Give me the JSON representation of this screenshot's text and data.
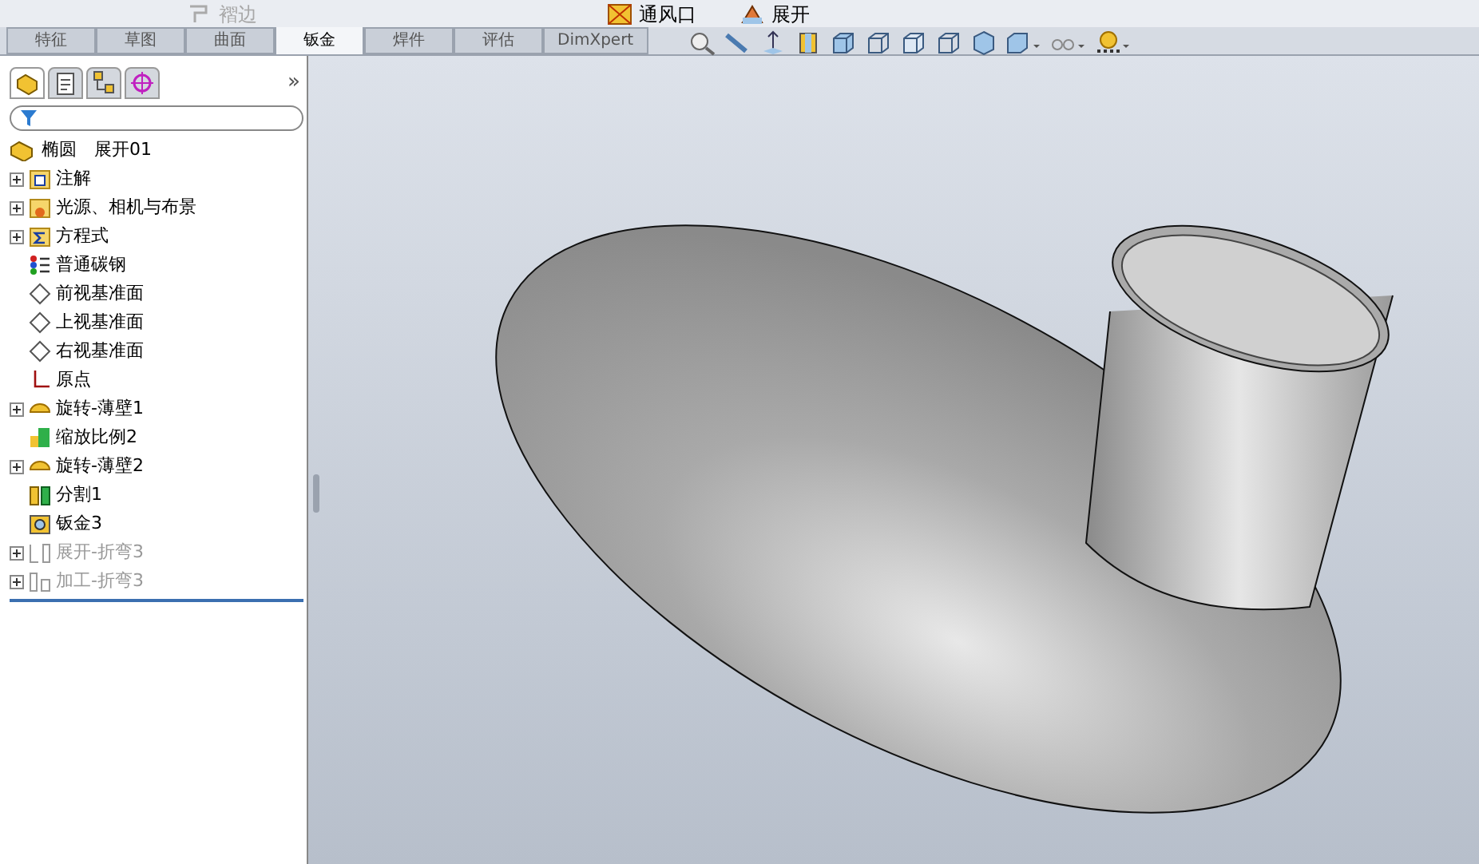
{
  "toolbar": {
    "items": [
      {
        "label": "褶边",
        "disabled": true
      },
      {
        "label": "通风口",
        "disabled": false
      },
      {
        "label": "展开",
        "disabled": false
      }
    ]
  },
  "tabs": [
    {
      "label": "特征",
      "selected": false
    },
    {
      "label": "草图",
      "selected": false
    },
    {
      "label": "曲面",
      "selected": false
    },
    {
      "label": "钣金",
      "selected": true
    },
    {
      "label": "焊件",
      "selected": false
    },
    {
      "label": "评估",
      "selected": false
    },
    {
      "label": "DimXpert",
      "selected": false
    }
  ],
  "panel_tabs": [
    {
      "kind": "feature",
      "selected": true
    },
    {
      "kind": "property",
      "selected": false
    },
    {
      "kind": "config",
      "selected": false
    },
    {
      "kind": "target",
      "selected": false
    }
  ],
  "panel_more": "»",
  "tree": {
    "root": "椭圆　展开01",
    "items": [
      {
        "label": "注解",
        "kind": "annotation",
        "expandable": true,
        "disabled": false
      },
      {
        "label": "光源、相机与布景",
        "kind": "lights",
        "expandable": true,
        "disabled": false
      },
      {
        "label": "方程式",
        "kind": "equation",
        "expandable": true,
        "disabled": false
      },
      {
        "label": "普通碳钢",
        "kind": "material",
        "expandable": false,
        "disabled": false
      },
      {
        "label": "前视基准面",
        "kind": "plane",
        "expandable": false,
        "disabled": false
      },
      {
        "label": "上视基准面",
        "kind": "plane",
        "expandable": false,
        "disabled": false
      },
      {
        "label": "右视基准面",
        "kind": "plane",
        "expandable": false,
        "disabled": false
      },
      {
        "label": "原点",
        "kind": "origin",
        "expandable": false,
        "disabled": false
      },
      {
        "label": "旋转-薄壁1",
        "kind": "revolve",
        "expandable": true,
        "disabled": false
      },
      {
        "label": "缩放比例2",
        "kind": "scale",
        "expandable": false,
        "disabled": false
      },
      {
        "label": "旋转-薄壁2",
        "kind": "revolve",
        "expandable": true,
        "disabled": false
      },
      {
        "label": "分割1",
        "kind": "split",
        "expandable": false,
        "disabled": false
      },
      {
        "label": "钣金3",
        "kind": "sheetmetal",
        "expandable": false,
        "disabled": false
      },
      {
        "label": "展开-折弯3",
        "kind": "flatten",
        "expandable": true,
        "disabled": true
      },
      {
        "label": "加工-折弯3",
        "kind": "process",
        "expandable": true,
        "disabled": true
      }
    ]
  }
}
